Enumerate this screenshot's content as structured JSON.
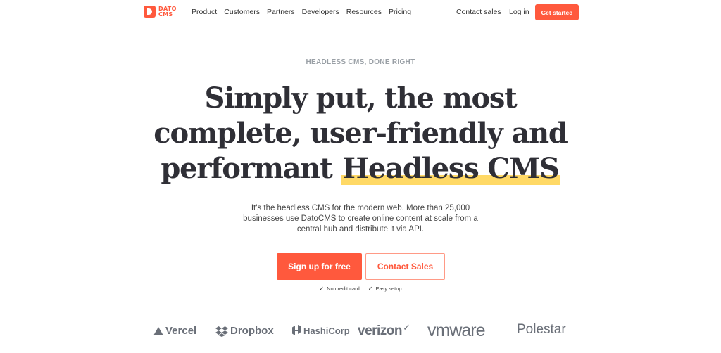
{
  "nav": {
    "logo_line1": "DATO",
    "logo_line2": "CMS",
    "links": [
      "Product",
      "Customers",
      "Partners",
      "Developers",
      "Resources",
      "Pricing"
    ],
    "contact_sales": "Contact sales",
    "login": "Log in",
    "get_started": "Get started"
  },
  "hero": {
    "eyebrow": "HEADLESS CMS, DONE RIGHT",
    "line1": "Simply put, the most",
    "line2": "complete, user-friendly and",
    "line3_prefix": "performant ",
    "line3_highlight": "Headless CMS",
    "subtitle": "It's the headless CMS for the modern web. More than 25,000 businesses use DatoCMS to create online content at scale from a central hub and distribute it via API.",
    "signup_label": "Sign up for free",
    "contact_label": "Contact Sales",
    "check1": "No credit card",
    "check2": "Easy setup"
  },
  "logos": {
    "vercel": "Vercel",
    "dropbox": "Dropbox",
    "hashicorp": "HashiCorp",
    "verizon": "verizon",
    "vmware": "vmware",
    "polestar": "Polestar"
  },
  "colors": {
    "accent": "#ff593d",
    "highlight": "#ffd966",
    "heading": "#2f2f36",
    "muted": "#9aa0a6"
  }
}
